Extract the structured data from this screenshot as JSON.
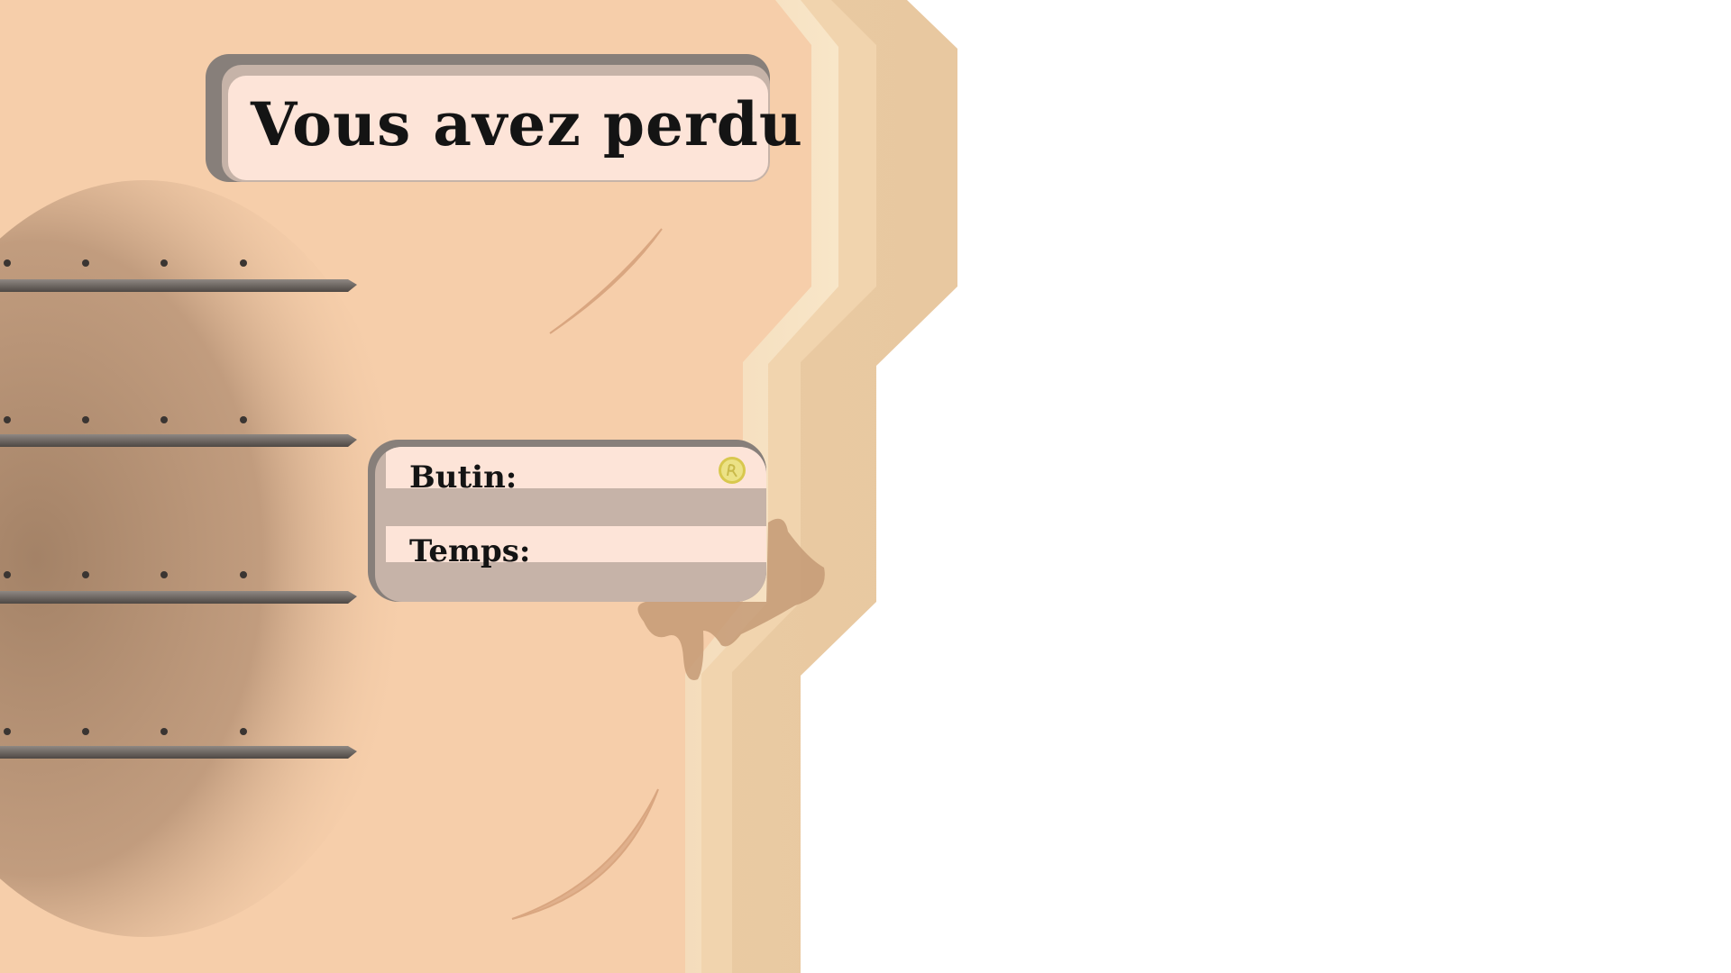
{
  "screen": {
    "title": "Vous avez perdu"
  },
  "stats": {
    "loot_label": "Butin:",
    "time_label": "Temps:",
    "loot_icon": "coin-icon"
  },
  "colors": {
    "panel": "#f6ceaa",
    "panel_edge": "#f0c69b",
    "shelf_shadow": "#a8866b",
    "box_border": "#877f7a",
    "box_mid": "#c6b3a8",
    "box_face": "#fde4d8",
    "coin": "#e6dc70",
    "stain": "#c49a76"
  }
}
